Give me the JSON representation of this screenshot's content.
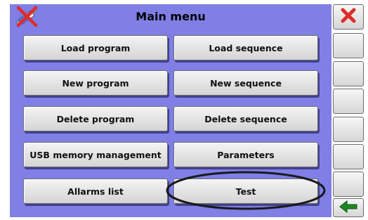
{
  "header": {
    "title": "Main menu",
    "logo_icon": "crossed-syringe-icon"
  },
  "menu": {
    "load_program": "Load program",
    "load_sequence": "Load sequence",
    "new_program": "New program",
    "new_sequence": "New sequence",
    "delete_program": "Delete program",
    "delete_sequence": "Delete sequence",
    "usb_memory": "USB memory management",
    "parameters": "Parameters",
    "alarms_list": "Allarms list",
    "test": "Test"
  },
  "side_panel": {
    "close_icon": "close-icon",
    "back_icon": "arrow-left-icon"
  },
  "colors": {
    "background": "#7f7fe6",
    "close_red": "#e02b2b",
    "back_green": "#1e8a1e",
    "highlight": "#1a1a1a"
  }
}
